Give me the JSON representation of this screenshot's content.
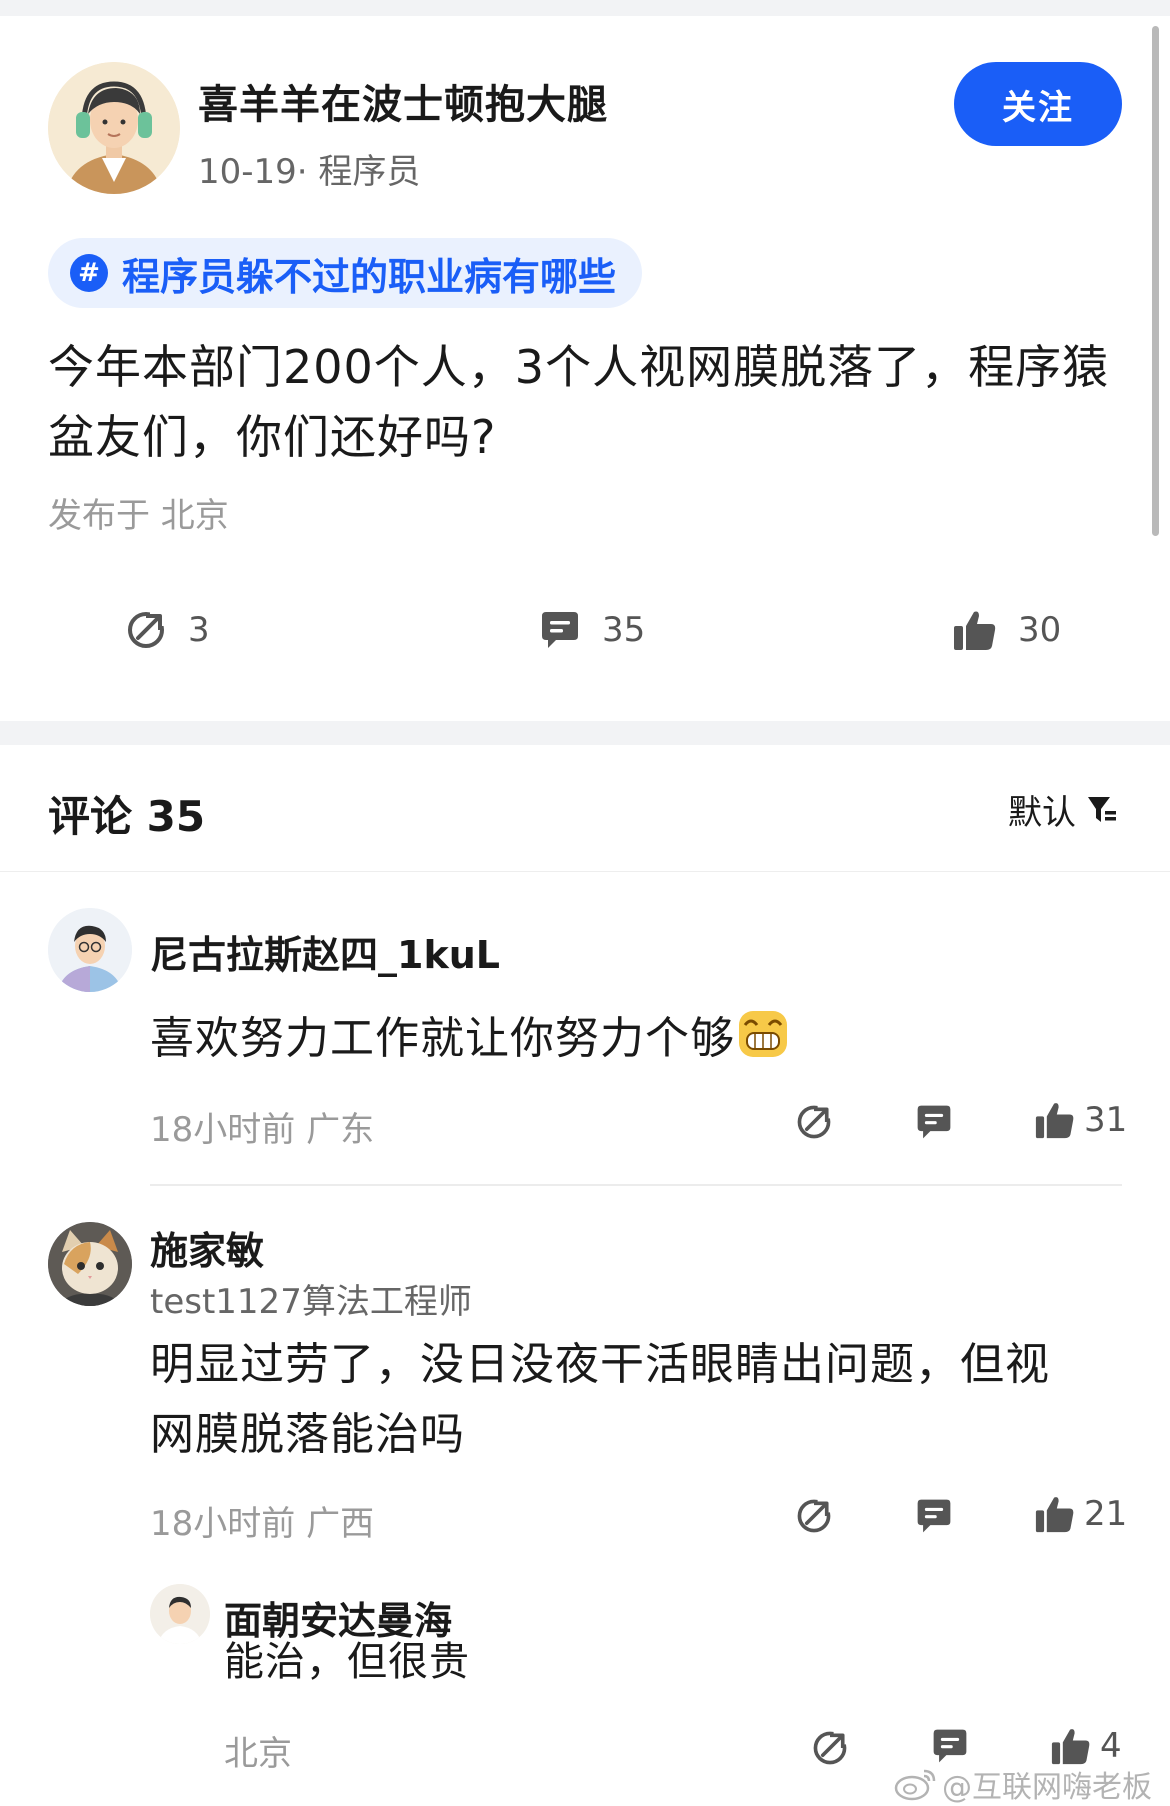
{
  "post": {
    "author_name": "喜羊羊在波士顿抱大腿",
    "author_meta": "10-19· 程序员",
    "follow_label": "关注",
    "topic": "程序员躲不过的职业病有哪些",
    "body": "今年本部门200个人，3个人视网膜脱落了，程序猿盆友们，你们还好吗?",
    "location": "发布于 北京",
    "share_count": "3",
    "comment_count": "35",
    "like_count": "30"
  },
  "comments_header": {
    "title": "评论 35",
    "sort_label": "默认"
  },
  "comments": [
    {
      "name": "尼古拉斯赵四_1kuL",
      "text": "喜欢努力工作就让你努力个够",
      "meta": "18小时前  广东",
      "likes": "31"
    },
    {
      "name": "施家敏",
      "subtitle": "test1127算法工程师",
      "text": "明显过劳了，没日没夜干活眼睛出问题，但视网膜脱落能治吗",
      "meta": "18小时前  广西",
      "likes": "21"
    }
  ],
  "reply": {
    "name": "面朝安达曼海",
    "text": "能治，但很贵",
    "meta": "北京",
    "likes": "4"
  },
  "watermark": "@互联网嗨老板",
  "colors": {
    "accent": "#1a5ef7",
    "topic_bg": "#eaf1fe",
    "separator": "#f2f3f5"
  }
}
